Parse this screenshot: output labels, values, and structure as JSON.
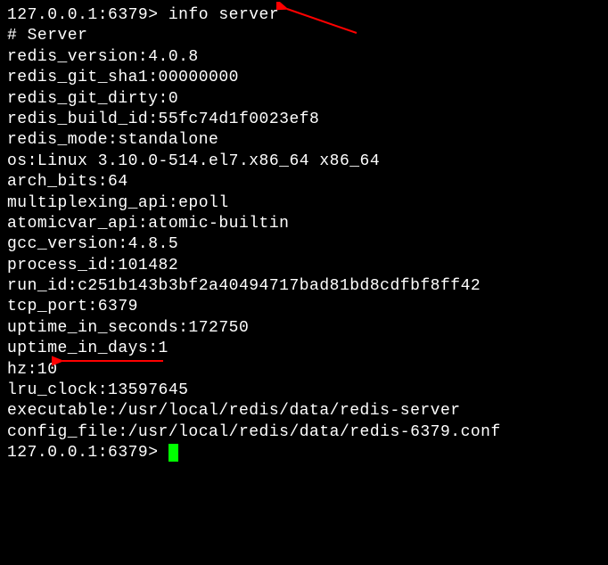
{
  "prompt1": {
    "prefix": "127.0.0.1:6379> ",
    "command": "info server"
  },
  "header": "# Server",
  "lines": [
    "redis_version:4.0.8",
    "redis_git_sha1:00000000",
    "redis_git_dirty:0",
    "redis_build_id:55fc74d1f0023ef8",
    "redis_mode:standalone",
    "os:Linux 3.10.0-514.el7.x86_64 x86_64",
    "arch_bits:64",
    "multiplexing_api:epoll",
    "atomicvar_api:atomic-builtin",
    "gcc_version:4.8.5",
    "process_id:101482",
    "run_id:c251b143b3bf2a40494717bad81bd8cdfbf8ff42",
    "tcp_port:6379",
    "uptime_in_seconds:172750",
    "uptime_in_days:1",
    "hz:10",
    "lru_clock:13597645",
    "executable:/usr/local/redis/data/redis-server",
    "config_file:/usr/local/redis/data/redis-6379.conf"
  ],
  "prompt2": {
    "prefix": "127.0.0.1:6379> "
  },
  "chart_data": {
    "type": "table",
    "title": "Redis INFO server output",
    "pairs": [
      {
        "key": "redis_version",
        "value": "4.0.8"
      },
      {
        "key": "redis_git_sha1",
        "value": "00000000"
      },
      {
        "key": "redis_git_dirty",
        "value": "0"
      },
      {
        "key": "redis_build_id",
        "value": "55fc74d1f0023ef8"
      },
      {
        "key": "redis_mode",
        "value": "standalone"
      },
      {
        "key": "os",
        "value": "Linux 3.10.0-514.el7.x86_64 x86_64"
      },
      {
        "key": "arch_bits",
        "value": "64"
      },
      {
        "key": "multiplexing_api",
        "value": "epoll"
      },
      {
        "key": "atomicvar_api",
        "value": "atomic-builtin"
      },
      {
        "key": "gcc_version",
        "value": "4.8.5"
      },
      {
        "key": "process_id",
        "value": "101482"
      },
      {
        "key": "run_id",
        "value": "c251b143b3bf2a40494717bad81bd8cdfbf8ff42"
      },
      {
        "key": "tcp_port",
        "value": "6379"
      },
      {
        "key": "uptime_in_seconds",
        "value": "172750"
      },
      {
        "key": "uptime_in_days",
        "value": "1"
      },
      {
        "key": "hz",
        "value": "10"
      },
      {
        "key": "lru_clock",
        "value": "13597645"
      },
      {
        "key": "executable",
        "value": "/usr/local/redis/data/redis-server"
      },
      {
        "key": "config_file",
        "value": "/usr/local/redis/data/redis-6379.conf"
      }
    ]
  }
}
